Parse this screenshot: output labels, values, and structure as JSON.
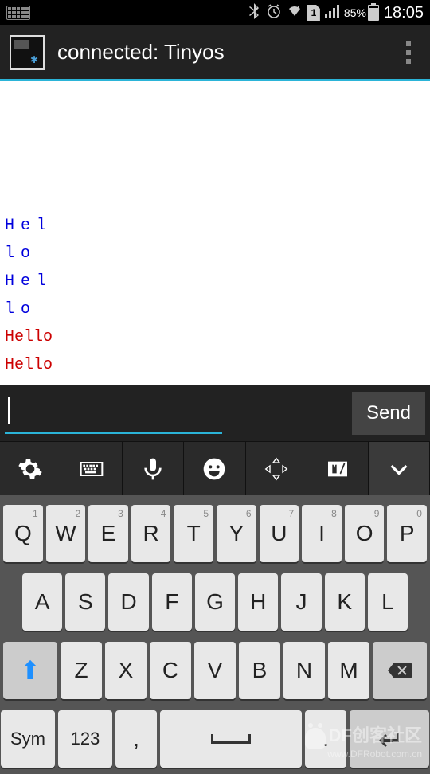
{
  "status": {
    "battery_pct": "85%",
    "time": "18:05"
  },
  "header": {
    "title": "connected: Tinyos"
  },
  "terminal": {
    "lines": [
      {
        "text": "Hel",
        "color": "blue"
      },
      {
        "text": "lo",
        "color": "blue"
      },
      {
        "text": "Hel",
        "color": "blue"
      },
      {
        "text": "lo",
        "color": "blue"
      },
      {
        "text": "Hello",
        "color": "red"
      },
      {
        "text": "Hello",
        "color": "red"
      }
    ]
  },
  "input": {
    "value": "",
    "send_label": "Send"
  },
  "keyboard": {
    "row1": [
      {
        "k": "Q",
        "n": "1"
      },
      {
        "k": "W",
        "n": "2"
      },
      {
        "k": "E",
        "n": "3"
      },
      {
        "k": "R",
        "n": "4"
      },
      {
        "k": "T",
        "n": "5"
      },
      {
        "k": "Y",
        "n": "6"
      },
      {
        "k": "U",
        "n": "7"
      },
      {
        "k": "I",
        "n": "8"
      },
      {
        "k": "O",
        "n": "9"
      },
      {
        "k": "P",
        "n": "0"
      }
    ],
    "row2": [
      "A",
      "S",
      "D",
      "F",
      "G",
      "H",
      "J",
      "K",
      "L"
    ],
    "row3": [
      "Z",
      "X",
      "C",
      "V",
      "B",
      "N",
      "M"
    ],
    "sym": "Sym",
    "num": "123",
    "comma": ",",
    "dot": "."
  },
  "watermark": {
    "main": "DF创客社区",
    "sub": "www.DFRobot.com.cn"
  }
}
